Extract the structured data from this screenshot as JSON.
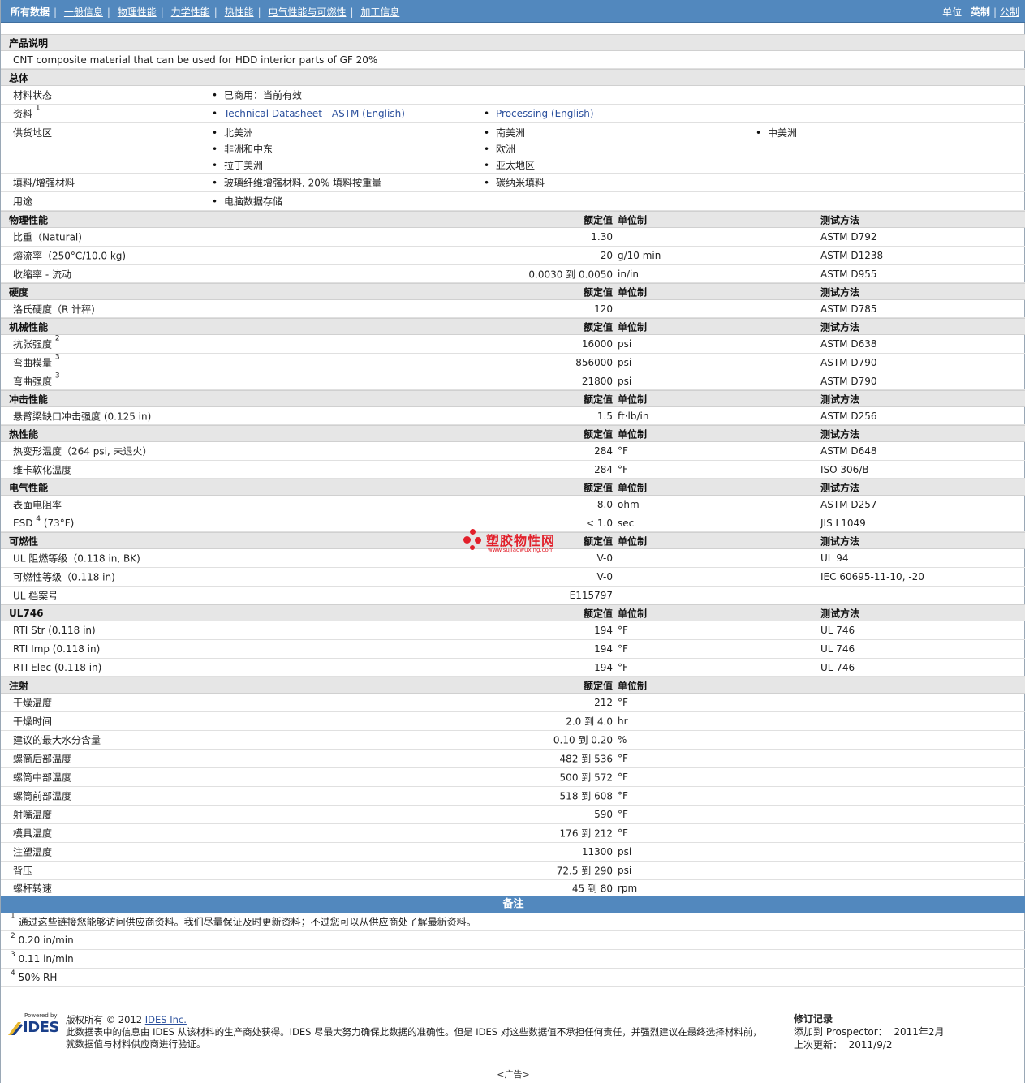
{
  "nav": {
    "tabs": [
      "所有数据",
      "一般信息",
      "物理性能",
      "力学性能",
      "热性能",
      "电气性能与可燃性",
      "加工信息"
    ],
    "unit_label": "单位",
    "unit_options": [
      "英制",
      "公制"
    ]
  },
  "product": {
    "heading": "产品说明",
    "description": "CNT composite material that can be used for HDD interior parts of GF 20%"
  },
  "general": {
    "heading": "总体",
    "status_label": "材料状态",
    "status_value": "已商用：当前有效",
    "docs_label": "资料",
    "docs_sup": "1",
    "doc1": "Technical Datasheet - ASTM (English)",
    "doc2": "Processing (English)",
    "regions_label": "供货地区",
    "regions": [
      "北美洲",
      "南美洲",
      "中美洲",
      "非洲和中东",
      "欧洲",
      "拉丁美洲",
      "亚太地区"
    ],
    "filler_label": "填料/增强材料",
    "filler1": "玻璃纤维增强材料, 20% 填料按重量",
    "filler2": "碳纳米填料",
    "use_label": "用途",
    "use_value": "电脑数据存储"
  },
  "col_headers": {
    "value": "额定值",
    "unit": "单位制",
    "test": "测试方法"
  },
  "sections": {
    "physical": "物理性能",
    "hardness": "硬度",
    "mechanical": "机械性能",
    "impact": "冲击性能",
    "thermal": "热性能",
    "electrical": "电气性能",
    "flammability": "可燃性",
    "ul746": "UL746",
    "injection": "注射"
  },
  "rows": {
    "sg": {
      "label": "比重（Natural)",
      "value": "1.30",
      "unit": "",
      "test": "ASTM D792"
    },
    "mfr": {
      "label": "熔流率（250°C/10.0 kg)",
      "value": "20",
      "unit": "g/10 min",
      "test": "ASTM D1238"
    },
    "shrink": {
      "label": "收缩率 - 流动",
      "value": "0.0030 到  0.0050",
      "unit": "in/in",
      "test": "ASTM D955"
    },
    "rockwell": {
      "label": "洛氏硬度（R 计秤)",
      "value": "120",
      "unit": "",
      "test": "ASTM D785"
    },
    "tensile": {
      "label": "抗张强度",
      "sup": "2",
      "value": "16000",
      "unit": "psi",
      "test": "ASTM D638"
    },
    "flexmod": {
      "label": "弯曲模量",
      "sup": "3",
      "value": "856000",
      "unit": "psi",
      "test": "ASTM D790"
    },
    "flexstr": {
      "label": "弯曲强度",
      "sup": "3",
      "value": "21800",
      "unit": "psi",
      "test": "ASTM D790"
    },
    "izod": {
      "label": "悬臂梁缺口冲击强度 (0.125 in)",
      "value": "1.5",
      "unit": "ft·lb/in",
      "test": "ASTM D256"
    },
    "hdt": {
      "label": "热变形温度（264 psi, 未退火）",
      "value": "284",
      "unit": "°F",
      "test": "ASTM D648"
    },
    "vicat": {
      "label": "维卡软化温度",
      "value": "284",
      "unit": "°F",
      "test": "ISO 306/B"
    },
    "surfres": {
      "label": "表面电阻率",
      "value": "8.0",
      "unit": "ohm",
      "test": "ASTM D257"
    },
    "esd": {
      "label": "ESD",
      "sup": "4",
      "label_suffix": " (73°F)",
      "value": "< 1.0",
      "unit": "sec",
      "test": "JIS L1049"
    },
    "ul_rating": {
      "label": "UL 阻燃等级（0.118 in, BK)",
      "value": "V-0",
      "unit": "",
      "test": "UL 94"
    },
    "flam_class": {
      "label": "可燃性等级（0.118 in)",
      "value": "V-0",
      "unit": "",
      "test": "IEC 60695-11-10, -20"
    },
    "ul_file": {
      "label": "UL 档案号",
      "value": "E115797",
      "unit": "",
      "test": ""
    },
    "rti_str": {
      "label": "RTI Str (0.118 in)",
      "value": "194",
      "unit": "°F",
      "test": "UL 746"
    },
    "rti_imp": {
      "label": "RTI Imp (0.118 in)",
      "value": "194",
      "unit": "°F",
      "test": "UL 746"
    },
    "rti_elec": {
      "label": "RTI Elec (0.118 in)",
      "value": "194",
      "unit": "°F",
      "test": "UL 746"
    },
    "dry_temp": {
      "label": "干燥温度",
      "value": "212",
      "unit": "°F"
    },
    "dry_time": {
      "label": "干燥时间",
      "value": "2.0 到  4.0",
      "unit": "hr"
    },
    "moisture": {
      "label": "建议的最大水分含量",
      "value": "0.10 到  0.20",
      "unit": "%"
    },
    "rear": {
      "label": "螺筒后部温度",
      "value": "482 到  536",
      "unit": "°F"
    },
    "middle": {
      "label": "螺筒中部温度",
      "value": "500 到  572",
      "unit": "°F"
    },
    "front": {
      "label": "螺筒前部温度",
      "value": "518 到  608",
      "unit": "°F"
    },
    "nozzle": {
      "label": "射嘴温度",
      "value": "590",
      "unit": "°F"
    },
    "mold": {
      "label": "模具温度",
      "value": "176 到  212",
      "unit": "°F"
    },
    "inj_pressure": {
      "label": "注塑温度",
      "value": "11300",
      "unit": "psi"
    },
    "back_pressure": {
      "label": "背压",
      "value": "72.5 到  290",
      "unit": "psi"
    },
    "screw": {
      "label": "螺杆转速",
      "value": "45 到  80",
      "unit": "rpm"
    }
  },
  "notes": {
    "heading": "备注",
    "items": [
      {
        "num": "1",
        "text": "通过这些链接您能够访问供应商资料。我们尽量保证及时更新资料；不过您可以从供应商处了解最新资料。"
      },
      {
        "num": "2",
        "text": "0.20 in/min"
      },
      {
        "num": "3",
        "text": "0.11 in/min"
      },
      {
        "num": "4",
        "text": "50% RH"
      }
    ]
  },
  "watermark": {
    "title": "塑胶物性网",
    "url": "www.sujiaowuxing.com"
  },
  "footer": {
    "powered_by": "Powered by",
    "logo_text": "IDES",
    "copyright_prefix": "版权所有  © 2012 ",
    "copyright_link": "IDES Inc.",
    "disclaimer1": "此数据表中的信息由  IDES 从该材料的生产商处获得。IDES 尽最大努力确保此数据的准确性。但是  IDES 对这些数据值不承担任何责任，并强烈建议在最终选择材料前，",
    "disclaimer2": "就数据值与材料供应商进行验证。",
    "rev_heading": "修订记录",
    "rev_added_label": "添加到  Prospector：",
    "rev_added_value": "2011年2月",
    "rev_updated_label": "上次更新：",
    "rev_updated_value": "2011/9/2",
    "ad": "<广告>"
  }
}
